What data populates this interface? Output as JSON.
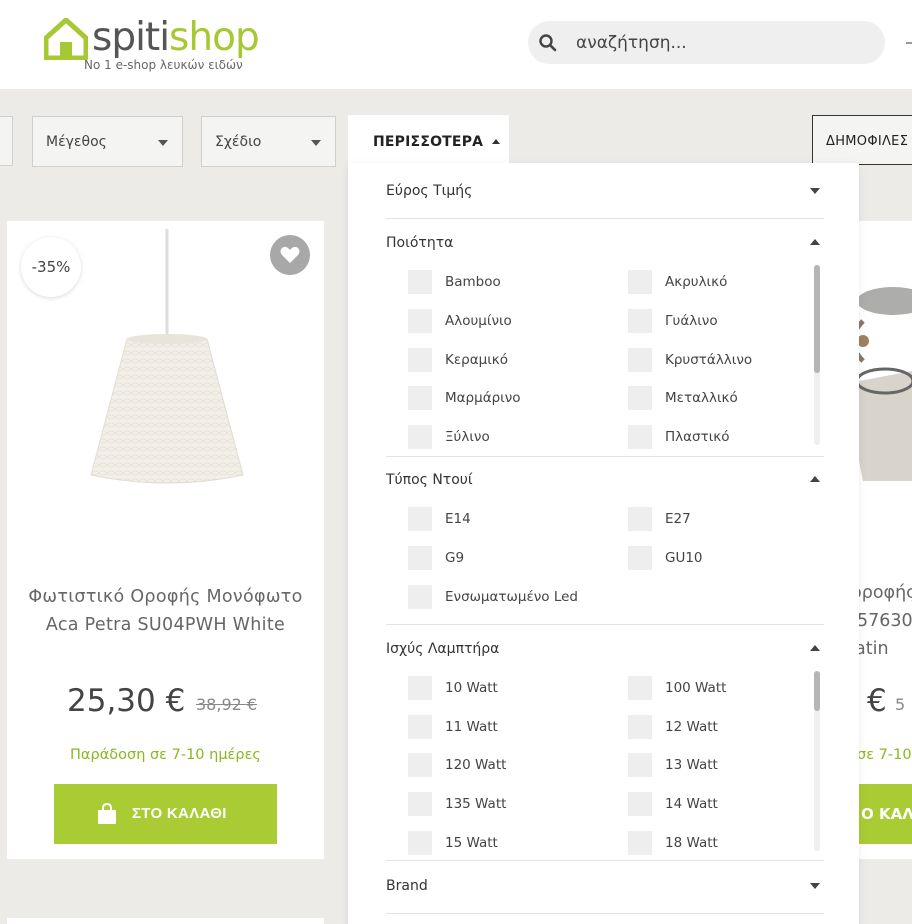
{
  "header": {
    "logo_spiti": "spiti",
    "logo_shop": "shop",
    "tagline": "No 1 e-shop λευκών ειδών",
    "search_placeholder": "αναζήτηση..."
  },
  "filters": {
    "size_label": "Μέγεθος",
    "design_label": "Σχέδιο",
    "more_label": "ΠΕΡΙΣΣΟΤΕΡΑ",
    "sort_label": "ΔΗΜΟΦΙΛΕΣ"
  },
  "panel": {
    "price_range": {
      "title": "Εύρος Τιμής"
    },
    "quality": {
      "title": "Ποιότητα",
      "options": [
        "Bamboo",
        "Ακρυλικό",
        "Αλουμίνιο",
        "Γυάλινο",
        "Κεραμικό",
        "Κρυστάλλινο",
        "Μαρμάρινο",
        "Μεταλλικό",
        "Ξύλινο",
        "Πλαστικό"
      ]
    },
    "socket": {
      "title": "Τύπος Ντουί",
      "options": [
        "E14",
        "E27",
        "G9",
        "GU10",
        "Ενσωματωμένο Led"
      ]
    },
    "power": {
      "title": "Ισχύς Λαμπτήρα",
      "options": [
        "10 Watt",
        "100 Watt",
        "11 Watt",
        "12 Watt",
        "120 Watt",
        "13 Watt",
        "135 Watt",
        "14 Watt",
        "15 Watt",
        "18 Watt"
      ]
    },
    "brand": {
      "title": "Brand"
    }
  },
  "product_left": {
    "discount": "-35%",
    "title": "Φωτιστικό Οροφής Μονόφωτο Aca Petra SU04PWH White",
    "price": "25,30 €",
    "old_price": "38,92 €",
    "delivery": "Παράδοση σε 7-10 ημέρες",
    "cart_label": "ΣΤΟ ΚΑΛΑΘΙ"
  },
  "product_right": {
    "title_line1": "οροφής",
    "title_line2": "57630",
    "title_line3": "atin",
    "price": "€",
    "old_price": "5",
    "delivery": "σε 7-10",
    "cart_label": "Ο ΚΑΛ"
  },
  "colors": {
    "brand_green": "#a9cc35",
    "text_green": "#8ab820",
    "background": "#ecebe8"
  }
}
